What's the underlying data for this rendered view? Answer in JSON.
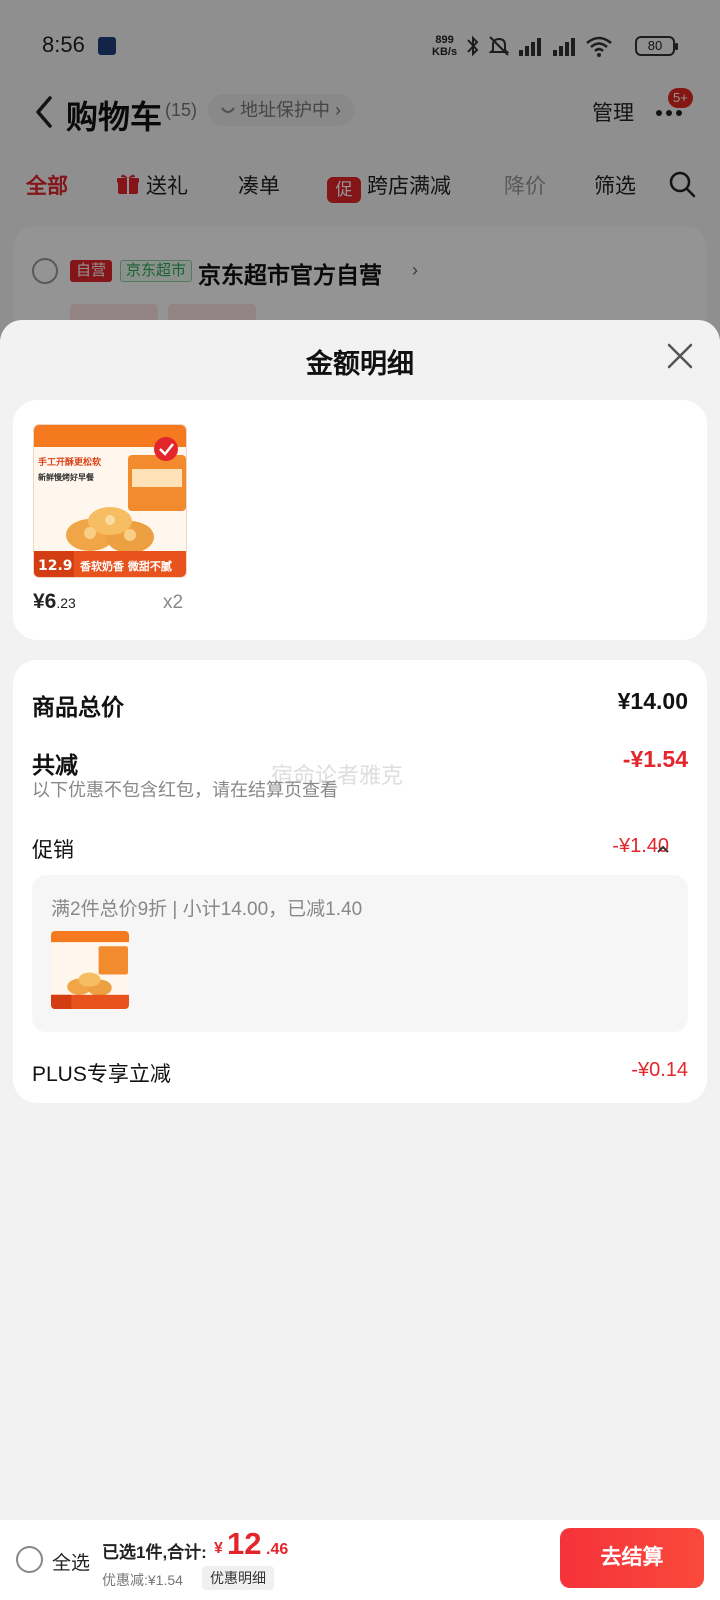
{
  "status_bar": {
    "time": "8:56",
    "net_speed_top": "899",
    "net_speed_bottom": "KB/s",
    "battery": "80"
  },
  "cart_header": {
    "title": "购物车",
    "count": "(15)",
    "address": "地址保护中",
    "manage": "管理",
    "badge": "5+"
  },
  "filter_tabs": {
    "all": "全部",
    "gift": "送礼",
    "bundle": "凑单",
    "promo_tag": "促",
    "cross_store": "跨店满减",
    "price_drop": "降价",
    "filter": "筛选"
  },
  "store": {
    "self_tag": "自营",
    "jd_tag": "京东超市",
    "name": "京东超市官方自营"
  },
  "sheet": {
    "title": "金额明细"
  },
  "product": {
    "price_int": "¥6",
    "price_dec": ".23",
    "qty": "x2",
    "image": {
      "headline": "手工开酥更松软",
      "subline": "新鲜慢烤好早餐",
      "badge_price": "12.9",
      "footer": "香软奶香 微甜不腻"
    }
  },
  "details": {
    "subtotal_label": "商品总价",
    "subtotal_value": "¥14.00",
    "total_discount_label": "共减",
    "total_discount_value": "-¥1.54",
    "discount_note": "以下优惠不包含红包，请在结算页查看",
    "promo_label": "促销",
    "promo_value": "-¥1.40",
    "promo_detail": "满2件总价9折 | 小计14.00，已减1.40",
    "plus_label": "PLUS专享立减",
    "plus_value": "-¥0.14",
    "watermark": "宿命论者雅克"
  },
  "bottom_bar": {
    "select_all": "全选",
    "selected_summary": "已选1件,合计:",
    "currency": "¥",
    "total_int": "12",
    "total_dec": ".46",
    "discount": "优惠减:¥1.54",
    "detail_link": "优惠明细",
    "checkout": "去结算"
  },
  "colors": {
    "accent_red": "#e3262c",
    "sheet_bg": "#f2f2f2",
    "card_bg": "#ffffff",
    "jd_green": "#2ea75a"
  }
}
